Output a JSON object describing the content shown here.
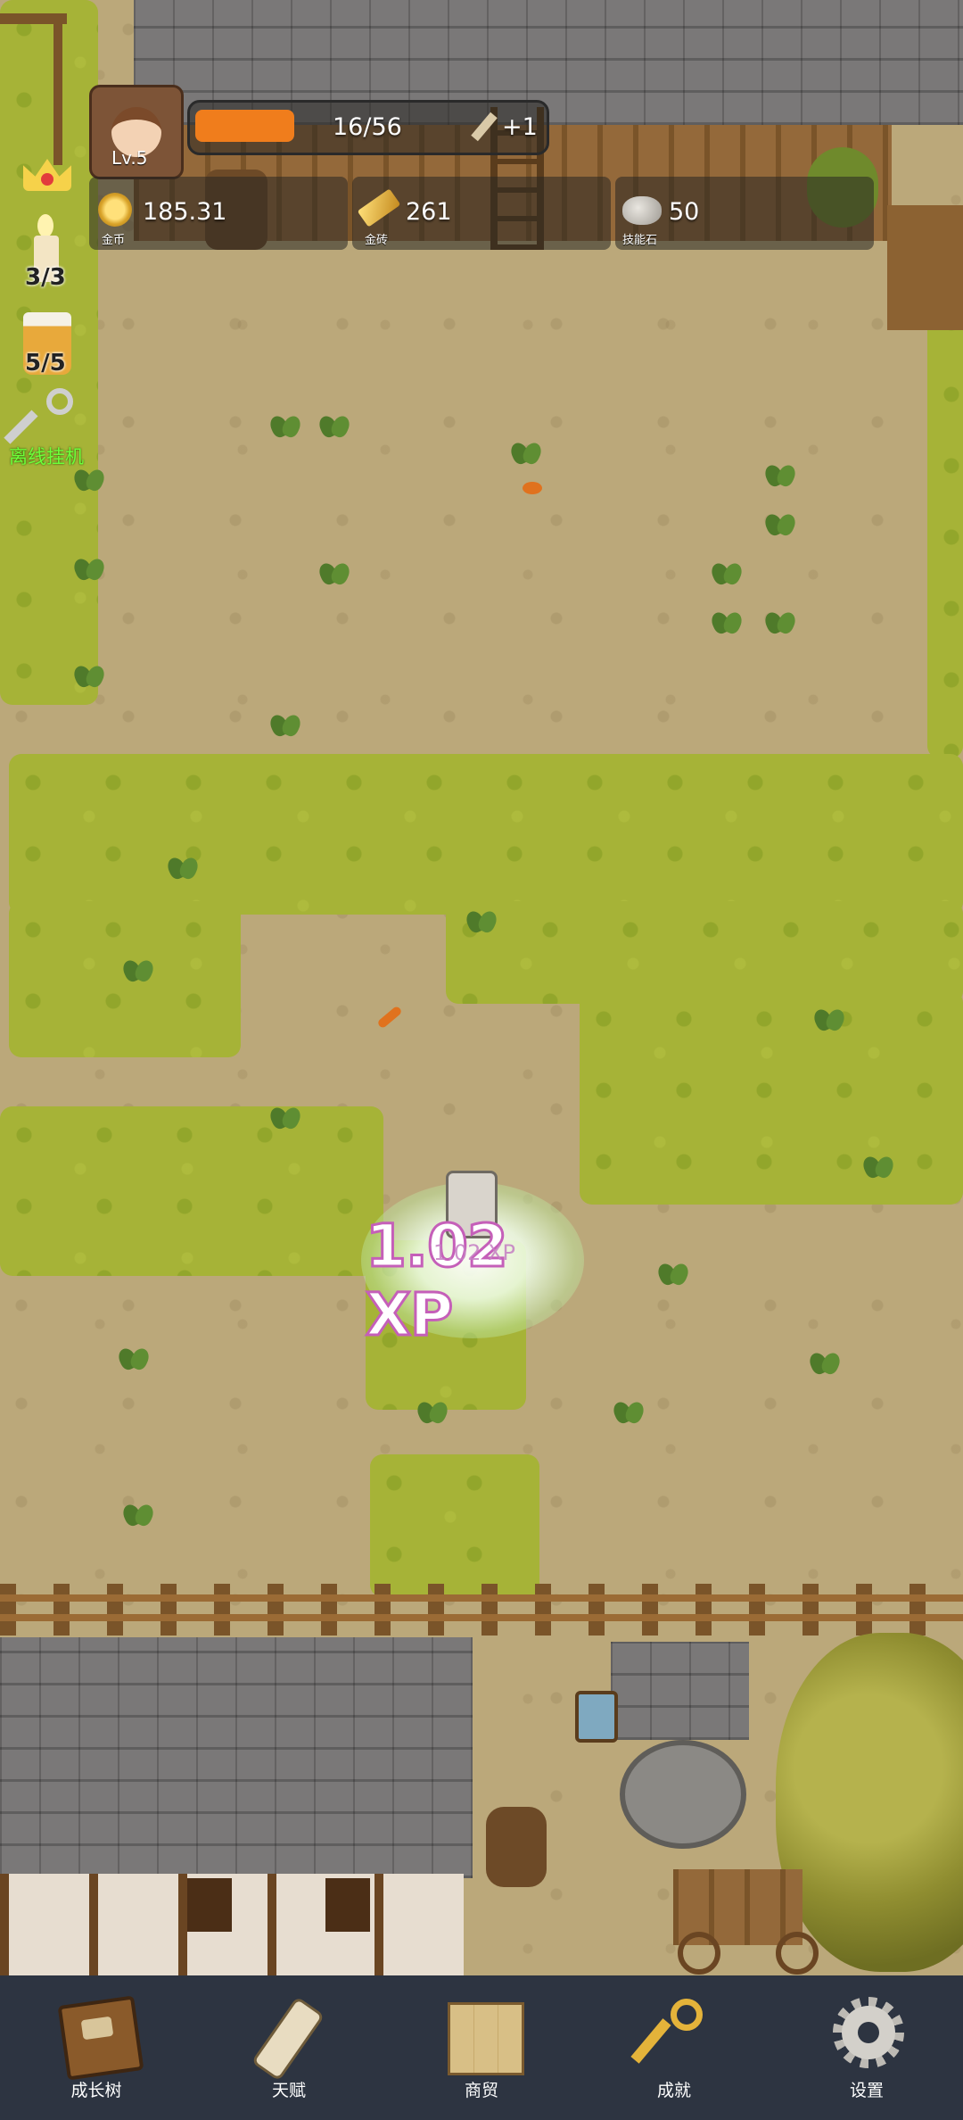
{
  "hud": {
    "level": "Lv.5",
    "xp_progress_text": "16/56",
    "xp_progress_fraction": 0.286,
    "bonus": "+1",
    "gold": {
      "value": "185.31",
      "label": "金币"
    },
    "gold_bar": {
      "value": "261",
      "label": "金砖"
    },
    "skill_stone": {
      "value": "50",
      "label": "技能石"
    }
  },
  "sidebar": {
    "candle_count": "3/3",
    "drink_count": "5/5",
    "idle_label": "离线挂机"
  },
  "popup": {
    "xp_big": "1.02 XP",
    "xp_small": "1.02 XP"
  },
  "nav": [
    {
      "label": "成长树",
      "icon": "book-icon"
    },
    {
      "label": "天赋",
      "icon": "scroll-icon"
    },
    {
      "label": "商贸",
      "icon": "map-icon"
    },
    {
      "label": "成就",
      "icon": "key-icon"
    },
    {
      "label": "设置",
      "icon": "gear-icon"
    }
  ],
  "colors": {
    "accent_orange": "#f07d1c",
    "idle_green": "#6dff3a",
    "nav_bg": "#2d3441"
  }
}
